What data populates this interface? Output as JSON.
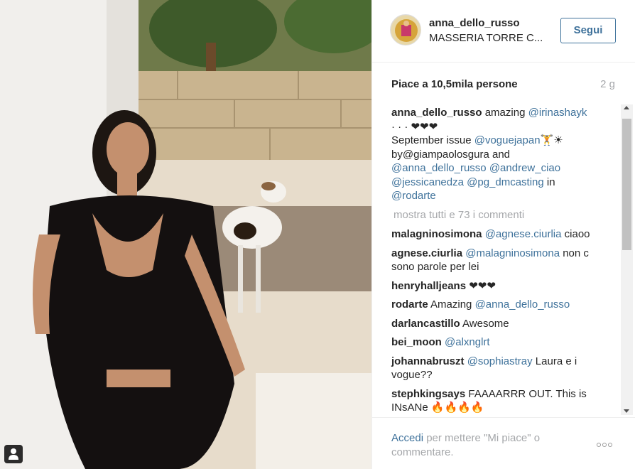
{
  "post": {
    "author": "anna_dello_russo",
    "location": "MASSERIA TORRE C...",
    "follow_label": "Segui",
    "likes": "Piace a 10,5mila persone",
    "time": "2 g"
  },
  "caption": {
    "user": "anna_dello_russo",
    "text1": " amazing ",
    "mention1": "@irinashayk",
    "text2": " · · · ❤❤❤",
    "text3": "September issue ",
    "mention2": "@voguejapan",
    "text4": "🏋☀",
    "text5": "by@giampaolosgura and",
    "mention3": "@anna_dello_russo",
    "mention4": "@andrew_ciao",
    "mention5": "@jessicanedza",
    "mention6": "@pg_dmcasting",
    "text6": " in",
    "mention7": "@rodarte"
  },
  "show_all": "mostra tutti e 73 i commenti",
  "comments": [
    {
      "user": "malagninosimona",
      "mention": "@agnese.ciurlia",
      "text": " ciaoo"
    },
    {
      "user": "agnese.ciurlia",
      "mention": "@malagninosimona",
      "text": " non c sono parole per lei"
    },
    {
      "user": "henryhalljeans",
      "mention": "",
      "text": " ❤❤❤"
    },
    {
      "user": "rodarte",
      "mention": "@anna_dello_russo",
      "text": "Amazing "
    },
    {
      "user": "darlancastillo",
      "mention": "",
      "text": " Awesome"
    },
    {
      "user": "bei_moon",
      "mention": "@alxnglrt",
      "text": " "
    },
    {
      "user": "johannabruszt",
      "mention": "@sophiastray",
      "text": " Laura e i vogue??"
    },
    {
      "user": "stephkingsays",
      "mention": "",
      "text": " FAAAARRR OUT. This is INsANe 🔥🔥🔥🔥"
    }
  ],
  "footer": {
    "login_link": "Accedi",
    "login_text": " per mettere \"Mi piace\" o commentare."
  },
  "colors": {
    "link": "#3f729b",
    "muted": "#a5a7aa",
    "text": "#262626"
  },
  "icons": {
    "user_tag": "person-icon",
    "more": "ellipsis-icon",
    "avatar": "profile-photo"
  }
}
